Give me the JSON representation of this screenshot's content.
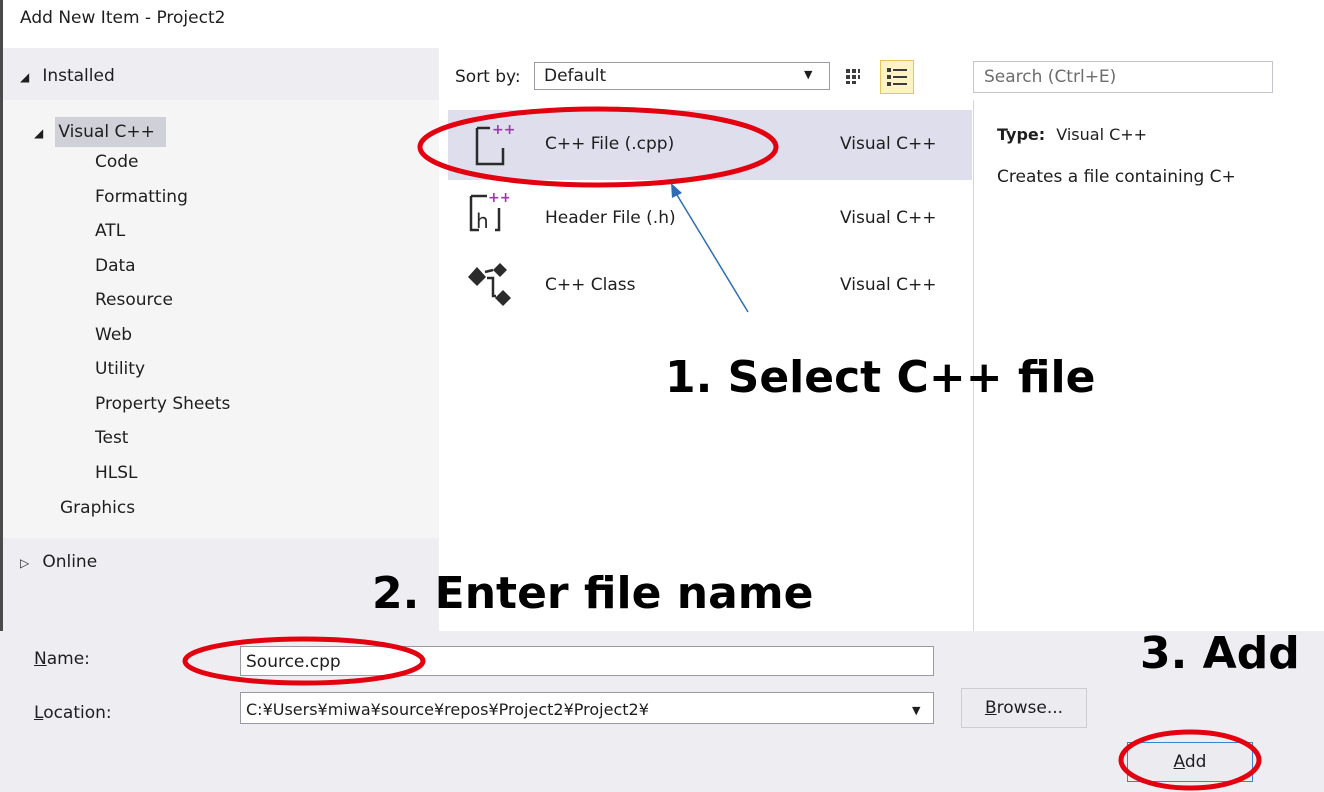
{
  "window": {
    "title": "Add New Item - Project2"
  },
  "tree": {
    "installed": "Installed",
    "visual_cpp": "Visual C++",
    "children": [
      "Code",
      "Formatting",
      "ATL",
      "Data",
      "Resource",
      "Web",
      "Utility",
      "Property Sheets",
      "Test",
      "HLSL"
    ],
    "graphics": "Graphics",
    "online": "Online"
  },
  "toolbar": {
    "sort_label": "Sort by:",
    "sort_value": "Default",
    "search_placeholder": "Search (Ctrl+E)"
  },
  "templates": [
    {
      "name": "C++ File (.cpp)",
      "type": "Visual C++",
      "icon": "cpp-file-icon",
      "selected": true
    },
    {
      "name": "Header File (.h)",
      "type": "Visual C++",
      "icon": "header-file-icon",
      "selected": false
    },
    {
      "name": "C++ Class",
      "type": "Visual C++",
      "icon": "class-icon",
      "selected": false
    }
  ],
  "details": {
    "type_label": "Type:",
    "type_value": "Visual C++",
    "description": "Creates a file containing C+"
  },
  "form": {
    "name_label_first": "N",
    "name_label_rest": "ame:",
    "name_value": "Source.cpp",
    "location_label_first": "L",
    "location_label_rest": "ocation:",
    "location_value": "C:¥Users¥miwa¥source¥repos¥Project2¥Project2¥",
    "browse_first": "B",
    "browse_rest": "rowse...",
    "add_first": "A",
    "add_rest": "dd"
  },
  "annotations": {
    "step1": "1. Select C++ file",
    "step2": "2. Enter file name",
    "step3": "3. Add"
  },
  "colors": {
    "annotation_ellipse": "#e3000f",
    "arrow": "#2e6db4",
    "selection": "#dedeed",
    "panel": "#eeeef2"
  }
}
